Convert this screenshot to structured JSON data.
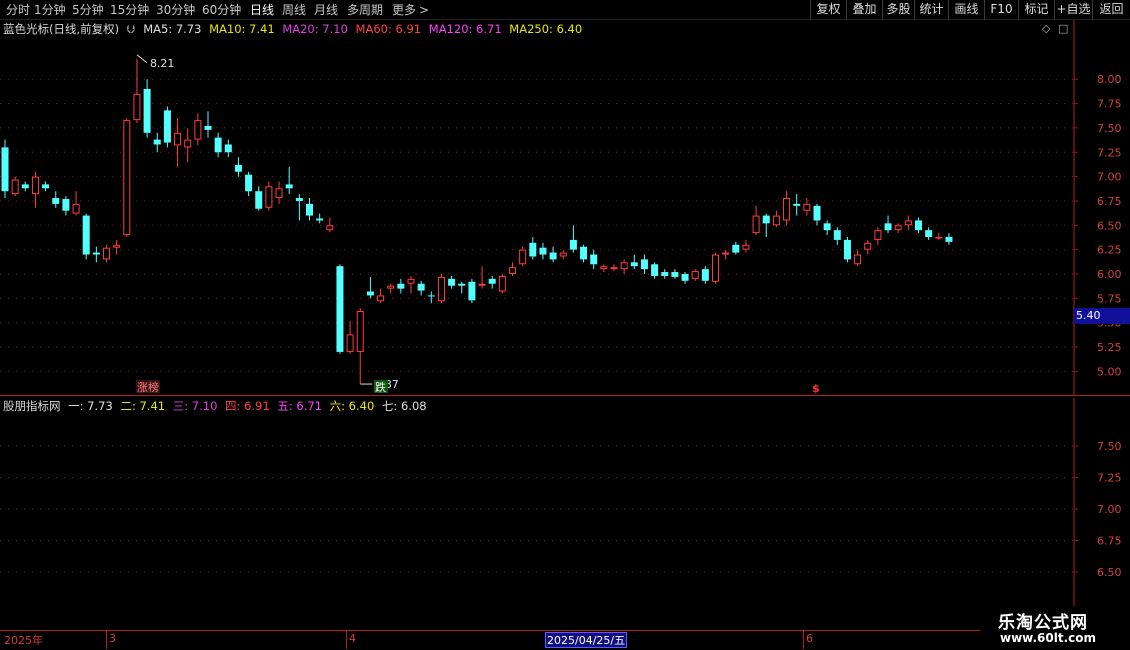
{
  "toolbar": {
    "periods": [
      "分时",
      "1分钟",
      "5分钟",
      "15分钟",
      "30分钟",
      "60分钟",
      "日线",
      "周线",
      "月线",
      "多周期",
      "更多"
    ],
    "more_arrow": ">",
    "buttons": [
      "复权",
      "叠加",
      "多股",
      "统计",
      "画线",
      "F10",
      "标记",
      "+自选",
      "返回"
    ]
  },
  "main_legend": {
    "indicator_name": "蓝色光标(日线,前复权)",
    "items": [
      {
        "label": "MA5: 7.73",
        "color": "#e0e0e0"
      },
      {
        "label": "MA10: 7.41",
        "color": "#e8e800"
      },
      {
        "label": "MA20: 7.10",
        "color": "#e040e0"
      },
      {
        "label": "MA60: 6.91",
        "color": "#ff4040"
      },
      {
        "label": "MA120: 6.71",
        "color": "#ff40ff"
      },
      {
        "label": "MA250: 6.40",
        "color": "#e8e800"
      }
    ]
  },
  "sub_legend": {
    "indicator_name": "股朋指标网",
    "items": [
      {
        "label": "一: 7.73",
        "color": "#e0e0e0"
      },
      {
        "label": "二: 7.41",
        "color": "#e8e800"
      },
      {
        "label": "三: 7.10",
        "color": "#e040e0"
      },
      {
        "label": "四: 6.91",
        "color": "#ff4040"
      },
      {
        "label": "五: 6.71",
        "color": "#ff40ff"
      },
      {
        "label": "六: 6.40",
        "color": "#e8e800"
      },
      {
        "label": "七: 6.08",
        "color": "#e0e0e0"
      }
    ]
  },
  "annotations": {
    "high_label": "8.21",
    "low_label": "4.87",
    "limit_up_badge": "涨榜",
    "drop_badge": "跌",
    "dollar_marker": "$"
  },
  "price_tag": "5.40",
  "date_axis": {
    "year_label": "2025年",
    "months": [
      "3",
      "4",
      "6"
    ],
    "cursor_date": "2025/04/25/五"
  },
  "watermark": {
    "title": "乐淘公式网",
    "url": "www.60lt.com"
  },
  "colors": {
    "up": "#ff3c3c",
    "down": "#54ffff",
    "grid": "#8b1a1a",
    "axis_text": "#d04040"
  },
  "chart_data": [
    {
      "type": "candlestick",
      "title": "蓝色光标(日线,前复权)",
      "ylim": [
        4.85,
        8.3
      ],
      "yticks": [
        5.0,
        5.25,
        5.5,
        5.75,
        6.0,
        6.25,
        6.5,
        6.75,
        7.0,
        7.25,
        7.5,
        7.75,
        8.0
      ],
      "candles": [
        {
          "o": 7.3,
          "c": 6.85,
          "h": 7.38,
          "l": 6.78
        },
        {
          "o": 6.82,
          "c": 6.97,
          "h": 7.0,
          "l": 6.8
        },
        {
          "o": 6.92,
          "c": 6.88,
          "h": 6.95,
          "l": 6.85
        },
        {
          "o": 6.82,
          "c": 7.0,
          "h": 7.05,
          "l": 6.68
        },
        {
          "o": 6.92,
          "c": 6.88,
          "h": 6.95,
          "l": 6.85
        },
        {
          "o": 6.78,
          "c": 6.72,
          "h": 6.85,
          "l": 6.68
        },
        {
          "o": 6.77,
          "c": 6.65,
          "h": 6.8,
          "l": 6.6
        },
        {
          "o": 6.62,
          "c": 6.72,
          "h": 6.85,
          "l": 6.6
        },
        {
          "o": 6.6,
          "c": 6.2,
          "h": 6.62,
          "l": 6.15
        },
        {
          "o": 6.22,
          "c": 6.2,
          "h": 6.28,
          "l": 6.12
        },
        {
          "o": 6.15,
          "c": 6.27,
          "h": 6.3,
          "l": 6.12
        },
        {
          "o": 6.27,
          "c": 6.3,
          "h": 6.35,
          "l": 6.2
        },
        {
          "o": 6.4,
          "c": 7.58,
          "h": 7.6,
          "l": 6.38
        },
        {
          "o": 7.58,
          "c": 7.85,
          "h": 8.21,
          "l": 7.55
        },
        {
          "o": 7.9,
          "c": 7.45,
          "h": 8.0,
          "l": 7.4
        },
        {
          "o": 7.38,
          "c": 7.33,
          "h": 7.45,
          "l": 7.25
        },
        {
          "o": 7.68,
          "c": 7.35,
          "h": 7.72,
          "l": 7.3
        },
        {
          "o": 7.32,
          "c": 7.45,
          "h": 7.6,
          "l": 7.1
        },
        {
          "o": 7.3,
          "c": 7.38,
          "h": 7.5,
          "l": 7.15
        },
        {
          "o": 7.38,
          "c": 7.58,
          "h": 7.65,
          "l": 7.32
        },
        {
          "o": 7.52,
          "c": 7.48,
          "h": 7.67,
          "l": 7.4
        },
        {
          "o": 7.4,
          "c": 7.25,
          "h": 7.45,
          "l": 7.2
        },
        {
          "o": 7.33,
          "c": 7.25,
          "h": 7.38,
          "l": 7.2
        },
        {
          "o": 7.12,
          "c": 7.05,
          "h": 7.2,
          "l": 7.0
        },
        {
          "o": 7.02,
          "c": 6.85,
          "h": 7.05,
          "l": 6.8
        },
        {
          "o": 6.85,
          "c": 6.67,
          "h": 6.9,
          "l": 6.65
        },
        {
          "o": 6.68,
          "c": 6.9,
          "h": 6.95,
          "l": 6.65
        },
        {
          "o": 6.78,
          "c": 6.88,
          "h": 6.95,
          "l": 6.72
        },
        {
          "o": 6.92,
          "c": 6.88,
          "h": 7.1,
          "l": 6.82
        },
        {
          "o": 6.78,
          "c": 6.75,
          "h": 6.82,
          "l": 6.55
        },
        {
          "o": 6.72,
          "c": 6.6,
          "h": 6.78,
          "l": 6.55
        },
        {
          "o": 6.57,
          "c": 6.55,
          "h": 6.62,
          "l": 6.52
        },
        {
          "o": 6.45,
          "c": 6.5,
          "h": 6.58,
          "l": 6.43
        },
        {
          "o": 6.08,
          "c": 5.2,
          "h": 6.1,
          "l": 5.18
        },
        {
          "o": 5.2,
          "c": 5.38,
          "h": 5.52,
          "l": 5.18
        },
        {
          "o": 5.2,
          "c": 5.62,
          "h": 5.65,
          "l": 4.87
        },
        {
          "o": 5.82,
          "c": 5.78,
          "h": 5.97,
          "l": 5.75
        },
        {
          "o": 5.72,
          "c": 5.78,
          "h": 5.85,
          "l": 5.7
        },
        {
          "o": 5.85,
          "c": 5.88,
          "h": 5.9,
          "l": 5.8
        },
        {
          "o": 5.9,
          "c": 5.85,
          "h": 5.95,
          "l": 5.8
        },
        {
          "o": 5.9,
          "c": 5.95,
          "h": 5.98,
          "l": 5.8
        },
        {
          "o": 5.9,
          "c": 5.83,
          "h": 5.93,
          "l": 5.78
        },
        {
          "o": 5.78,
          "c": 5.77,
          "h": 5.82,
          "l": 5.7
        },
        {
          "o": 5.72,
          "c": 5.97,
          "h": 6.0,
          "l": 5.7
        },
        {
          "o": 5.95,
          "c": 5.88,
          "h": 5.98,
          "l": 5.85
        },
        {
          "o": 5.9,
          "c": 5.88,
          "h": 5.92,
          "l": 5.8
        },
        {
          "o": 5.92,
          "c": 5.73,
          "h": 5.95,
          "l": 5.7
        },
        {
          "o": 5.88,
          "c": 5.9,
          "h": 6.08,
          "l": 5.85
        },
        {
          "o": 5.95,
          "c": 5.9,
          "h": 5.98,
          "l": 5.85
        },
        {
          "o": 5.82,
          "c": 5.98,
          "h": 6.0,
          "l": 5.8
        },
        {
          "o": 6.0,
          "c": 6.07,
          "h": 6.12,
          "l": 5.98
        },
        {
          "o": 6.1,
          "c": 6.25,
          "h": 6.28,
          "l": 6.08
        },
        {
          "o": 6.32,
          "c": 6.18,
          "h": 6.38,
          "l": 6.15
        },
        {
          "o": 6.27,
          "c": 6.2,
          "h": 6.32,
          "l": 6.15
        },
        {
          "o": 6.22,
          "c": 6.15,
          "h": 6.28,
          "l": 6.12
        },
        {
          "o": 6.18,
          "c": 6.22,
          "h": 6.25,
          "l": 6.15
        },
        {
          "o": 6.35,
          "c": 6.25,
          "h": 6.5,
          "l": 6.22
        },
        {
          "o": 6.28,
          "c": 6.15,
          "h": 6.3,
          "l": 6.12
        },
        {
          "o": 6.2,
          "c": 6.1,
          "h": 6.25,
          "l": 6.05
        },
        {
          "o": 6.05,
          "c": 6.08,
          "h": 6.1,
          "l": 6.02
        },
        {
          "o": 6.05,
          "c": 6.07,
          "h": 6.1,
          "l": 6.03
        },
        {
          "o": 6.05,
          "c": 6.12,
          "h": 6.15,
          "l": 6.0
        },
        {
          "o": 6.12,
          "c": 6.08,
          "h": 6.2,
          "l": 6.05
        },
        {
          "o": 6.15,
          "c": 6.05,
          "h": 6.2,
          "l": 6.0
        },
        {
          "o": 6.1,
          "c": 5.98,
          "h": 6.12,
          "l": 5.95
        },
        {
          "o": 6.02,
          "c": 5.98,
          "h": 6.05,
          "l": 5.95
        },
        {
          "o": 6.02,
          "c": 5.97,
          "h": 6.05,
          "l": 5.95
        },
        {
          "o": 6.0,
          "c": 5.93,
          "h": 6.02,
          "l": 5.9
        },
        {
          "o": 5.95,
          "c": 6.03,
          "h": 6.05,
          "l": 5.93
        },
        {
          "o": 6.05,
          "c": 5.93,
          "h": 6.08,
          "l": 5.9
        },
        {
          "o": 5.92,
          "c": 6.2,
          "h": 6.22,
          "l": 5.9
        },
        {
          "o": 6.2,
          "c": 6.22,
          "h": 6.25,
          "l": 6.15
        },
        {
          "o": 6.3,
          "c": 6.22,
          "h": 6.33,
          "l": 6.2
        },
        {
          "o": 6.25,
          "c": 6.3,
          "h": 6.35,
          "l": 6.22
        },
        {
          "o": 6.42,
          "c": 6.6,
          "h": 6.7,
          "l": 6.4
        },
        {
          "o": 6.6,
          "c": 6.52,
          "h": 6.62,
          "l": 6.38
        },
        {
          "o": 6.5,
          "c": 6.6,
          "h": 6.65,
          "l": 6.48
        },
        {
          "o": 6.55,
          "c": 6.78,
          "h": 6.85,
          "l": 6.5
        },
        {
          "o": 6.72,
          "c": 6.7,
          "h": 6.82,
          "l": 6.6
        },
        {
          "o": 6.65,
          "c": 6.72,
          "h": 6.78,
          "l": 6.6
        },
        {
          "o": 6.7,
          "c": 6.55,
          "h": 6.72,
          "l": 6.5
        },
        {
          "o": 6.52,
          "c": 6.45,
          "h": 6.55,
          "l": 6.4
        },
        {
          "o": 6.45,
          "c": 6.35,
          "h": 6.48,
          "l": 6.3
        },
        {
          "o": 6.35,
          "c": 6.15,
          "h": 6.38,
          "l": 6.12
        },
        {
          "o": 6.1,
          "c": 6.2,
          "h": 6.25,
          "l": 6.08
        },
        {
          "o": 6.25,
          "c": 6.32,
          "h": 6.35,
          "l": 6.2
        },
        {
          "o": 6.35,
          "c": 6.45,
          "h": 6.48,
          "l": 6.3
        },
        {
          "o": 6.52,
          "c": 6.45,
          "h": 6.6,
          "l": 6.42
        },
        {
          "o": 6.45,
          "c": 6.5,
          "h": 6.52,
          "l": 6.42
        },
        {
          "o": 6.5,
          "c": 6.55,
          "h": 6.6,
          "l": 6.45
        },
        {
          "o": 6.55,
          "c": 6.45,
          "h": 6.58,
          "l": 6.42
        },
        {
          "o": 6.45,
          "c": 6.38,
          "h": 6.48,
          "l": 6.35
        },
        {
          "o": 6.38,
          "c": 6.38,
          "h": 6.42,
          "l": 6.35
        },
        {
          "o": 6.38,
          "c": 6.33,
          "h": 6.42,
          "l": 6.3
        }
      ]
    },
    {
      "type": "line",
      "title": "股朋指标网",
      "ylim": [
        6.35,
        7.85
      ],
      "yticks": [
        6.5,
        6.75,
        7.0,
        7.25,
        7.5
      ],
      "series": []
    }
  ]
}
